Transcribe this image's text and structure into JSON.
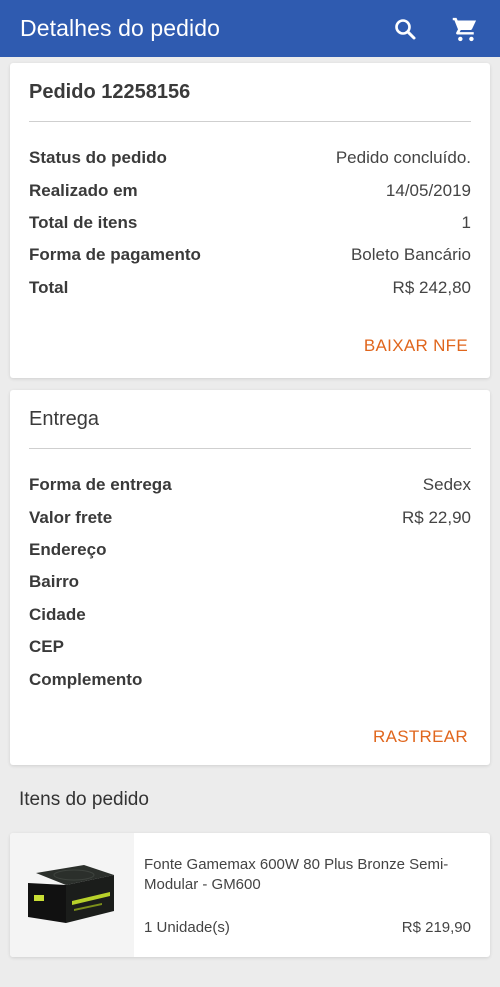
{
  "appbar": {
    "title": "Detalhes do pedido",
    "icons": [
      "search-icon",
      "cart-icon"
    ],
    "color": "#2f5bb0"
  },
  "order": {
    "title": "Pedido 12258156",
    "rows": [
      {
        "label": "Status do pedido",
        "value": "Pedido concluído."
      },
      {
        "label": "Realizado em",
        "value": "14/05/2019"
      },
      {
        "label": "Total de itens",
        "value": "1"
      },
      {
        "label": "Forma de pagamento",
        "value": "Boleto Bancário"
      },
      {
        "label": "Total",
        "value": "R$ 242,80"
      }
    ],
    "action": "BAIXAR NFE"
  },
  "delivery": {
    "title": "Entrega",
    "rows": [
      {
        "label": "Forma de entrega",
        "value": "Sedex"
      },
      {
        "label": "Valor frete",
        "value": "R$ 22,90"
      },
      {
        "label": "Endereço",
        "value": ""
      },
      {
        "label": "Bairro",
        "value": ""
      },
      {
        "label": "Cidade",
        "value": ""
      },
      {
        "label": "CEP",
        "value": ""
      },
      {
        "label": "Complemento",
        "value": ""
      }
    ],
    "action": "RASTREAR"
  },
  "items_section": {
    "heading": "Itens do pedido",
    "items": [
      {
        "name": "Fonte Gamemax 600W 80 Plus Bronze Semi-Modular - GM600",
        "quantity": "1 Unidade(s)",
        "price": "R$ 219,90",
        "image": "power-supply-image"
      }
    ]
  },
  "accent_color": "#e0661d"
}
